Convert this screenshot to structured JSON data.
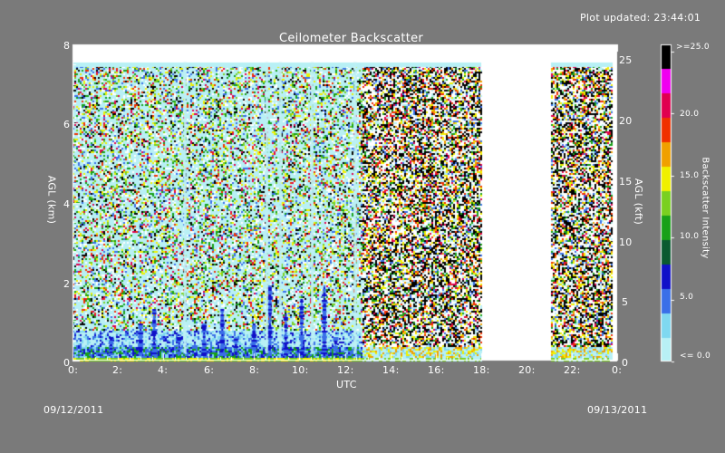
{
  "plot_updated": "Plot updated: 23:44:01",
  "date_left": "09/12/2011",
  "date_right": "09/13/2011",
  "colors": {
    "background": "#7a7a7a",
    "plot_bg": "#ffffff",
    "missing_data": "#ffffff"
  },
  "chart_data": {
    "type": "heatmap",
    "title": "Ceilometer Backscatter",
    "xlabel": "UTC",
    "ylabel_left": "AGL (km)",
    "ylabel_right": "AGL (kft)",
    "colorbar_label": "Backscatter Intensity",
    "x_ticks": [
      "0:",
      "2:",
      "4:",
      "6:",
      "8:",
      "10:",
      "12:",
      "14:",
      "16:",
      "18:",
      "20:",
      "22:",
      "0:"
    ],
    "x_tick_values": [
      0,
      2,
      4,
      6,
      8,
      10,
      12,
      14,
      16,
      18,
      20,
      22,
      24
    ],
    "xlim": [
      0,
      24
    ],
    "y_left_ticks": [
      "0",
      "2",
      "4",
      "6",
      "8"
    ],
    "y_left_tick_values": [
      0,
      2,
      4,
      6,
      8
    ],
    "ylim_km": [
      0,
      8
    ],
    "y_right_ticks": [
      "0",
      "5",
      "10",
      "15",
      "20",
      "25"
    ],
    "y_right_tick_values": [
      0,
      5,
      10,
      15,
      20,
      25
    ],
    "ylim_kft": [
      0,
      26.25
    ],
    "data_top_km": 7.55,
    "data_segments_hours": [
      [
        0,
        18
      ],
      [
        21.1,
        23.8
      ]
    ],
    "gap_hours": [
      18,
      21.1
    ],
    "noise_change_hour": 12.7,
    "colorbar_ticks": [
      "<= 0.0",
      "5.0",
      "10.0",
      "15.0",
      "20.0",
      ">=25.0"
    ],
    "colorbar_tick_values": [
      0,
      5,
      10,
      15,
      20,
      25
    ],
    "colorscale": [
      "#b8f0f5",
      "#7fd8f0",
      "#3a6fe8",
      "#1010c8",
      "#0a5a30",
      "#18a018",
      "#7ad020",
      "#f0f000",
      "#f0a000",
      "#f03000",
      "#e00050",
      "#f000f0",
      "#000000"
    ]
  }
}
